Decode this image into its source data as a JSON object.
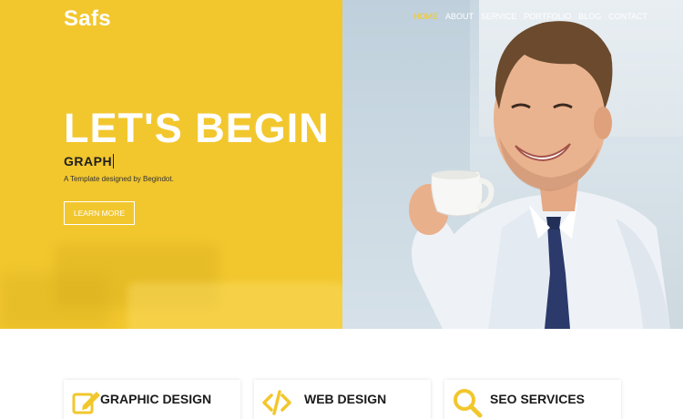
{
  "brand": {
    "logo": "Safs",
    "accent_color": "#f2c72e"
  },
  "nav": {
    "items": [
      {
        "label": "HOME",
        "active": true
      },
      {
        "label": "ABOUT",
        "active": false
      },
      {
        "label": "SERVICE",
        "active": false
      },
      {
        "label": "PORTFOLIO",
        "active": false
      },
      {
        "label": "BLOG",
        "active": false
      },
      {
        "label": "CONTACT",
        "active": false
      }
    ]
  },
  "hero": {
    "title": "LET'S BEGIN",
    "typed_text": "GRAPH",
    "credit": "A Template designed by Begindot.",
    "button_label": "LEARN MORE"
  },
  "services": {
    "items": [
      {
        "title": "GRAPHIC DESIGN",
        "icon": "edit-icon"
      },
      {
        "title": "WEB DESIGN",
        "icon": "code-icon"
      },
      {
        "title": "SEO SERVICES",
        "icon": "search-icon"
      }
    ]
  }
}
